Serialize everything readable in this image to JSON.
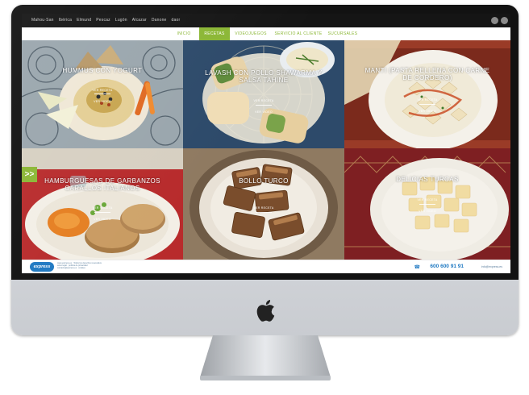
{
  "topbar": {
    "brands": [
      "Mahou·San",
      "Ibérica",
      "Elmund",
      "Pescaz",
      "Lugón",
      "Alcazar",
      "Danone",
      "daor"
    ]
  },
  "nav": {
    "items": [
      "INICIO",
      "RECETAS",
      "VIDEOJUEGOS",
      "SERVICIO AL CLIENTE",
      "SUCURSALES"
    ],
    "active_index": 1
  },
  "recipes": [
    {
      "title": "HUMMUS CON YOGURT",
      "link1": "VER RECETA",
      "link2": "VER VIDEO"
    },
    {
      "title": "LAVASH CON POLLO SHAWARMA Y SALSA TAHINE",
      "link1": "VER RECETA",
      "link2": "VER VIDEO"
    },
    {
      "title": "MANTI (PASTA RELLENA CON CARNE DE CORDERO)",
      "link1": "VER RECETA",
      "link2": "VER VIDEO"
    },
    {
      "title": "HAMBURGUESAS DE GARBANZOS CARALLOS ITALIANOS",
      "link1": "VER RECETA",
      "link2": "VER VIDEO"
    },
    {
      "title": "BOLLO TURCO",
      "link1": "VER RECETA",
      "link2": ""
    },
    {
      "title": "DELICIAS TURCAS",
      "link1": "VER RECETA",
      "link2": "VER VIDEO"
    }
  ],
  "arrow_button": {
    "label": ">>"
  },
  "footer": {
    "logo": "express",
    "lines": [
      "www.express.es · Todos los derechos reservados",
      "aviso legal · política de privacidad",
      "contacto@express.es · cookies"
    ],
    "phone_icon": "☎",
    "phone": "600 600 91 91",
    "email": "info@express.es"
  },
  "colors": {
    "accent": "#8bb735",
    "brand_blue": "#1f79c2"
  }
}
